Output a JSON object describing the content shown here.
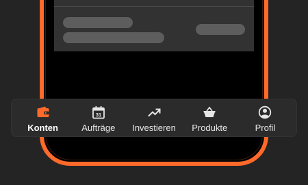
{
  "colors": {
    "accent": "#ff6a2b",
    "background": "#242424",
    "navbar": "#2b2b2b",
    "skeleton": "#5d5d5d"
  },
  "nav": {
    "items": [
      {
        "label": "Konten",
        "icon": "wallet-icon",
        "active": true
      },
      {
        "label": "Aufträge",
        "icon": "calendar-icon",
        "active": false
      },
      {
        "label": "Investieren",
        "icon": "trending-up-icon",
        "active": false
      },
      {
        "label": "Produkte",
        "icon": "basket-icon",
        "active": false
      },
      {
        "label": "Profil",
        "icon": "profile-icon",
        "active": false
      }
    ]
  }
}
